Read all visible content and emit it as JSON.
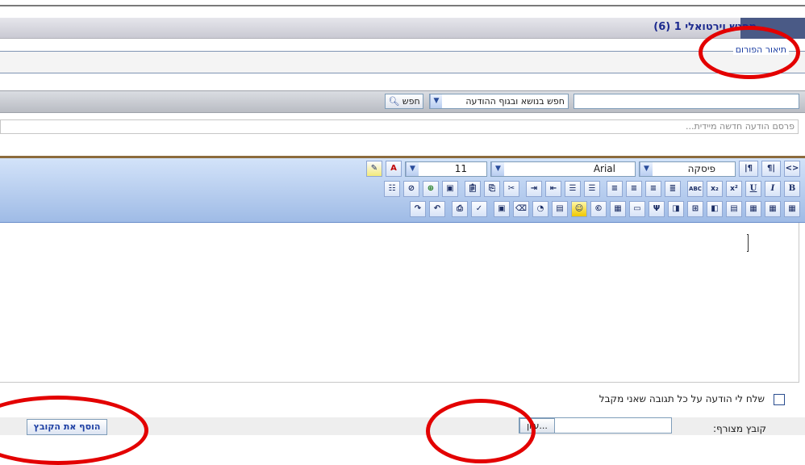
{
  "header": {
    "title": "מפגש וירטואלי 1 (6)"
  },
  "forum": {
    "legend": "תיאור הפורום"
  },
  "search": {
    "input_value": "",
    "scope_selected": "חפש בנושא ובגוף ההודעה",
    "button_label": "חפש"
  },
  "quickpost": {
    "placeholder": "פרסם הודעה חדשה מיידית..."
  },
  "editor": {
    "format_selected": "פיסקה",
    "font_selected": "Arial",
    "size_selected": "11",
    "row1_buttons": [
      "<>",
      "¶|",
      "|¶"
    ],
    "row2_buttons": [
      "B",
      "I",
      "U",
      "x²",
      "x₂",
      "ABC"
    ],
    "content": ""
  },
  "notify": {
    "label": "שלח לי הודעה על כל תגובה שאני מקבל",
    "checked": false
  },
  "attachment": {
    "label": "קובץ מצורף:",
    "file_value": "",
    "browse_label": "...עיון",
    "add_button_label": "הוסף את הקובץ"
  },
  "colors": {
    "annotation": "#e30000",
    "title_text": "#1d2b8f",
    "toolbar_bg": "#b9cdf0"
  },
  "icons": [
    "search-icon",
    "bold-icon",
    "italic-icon",
    "underline-icon",
    "superscript-icon",
    "subscript-icon",
    "spellcheck-icon",
    "align-left-icon",
    "align-center-icon",
    "align-right-icon",
    "justify-icon",
    "ordered-list-icon",
    "unordered-list-icon",
    "outdent-icon",
    "indent-icon",
    "cut-icon",
    "copy-icon",
    "paste-icon",
    "image-icon",
    "link-icon",
    "unlink-icon",
    "text-color-icon",
    "highlight-icon",
    "undo-icon",
    "redo-icon",
    "print-icon",
    "table-icon",
    "smiley-icon",
    "copyright-icon"
  ]
}
